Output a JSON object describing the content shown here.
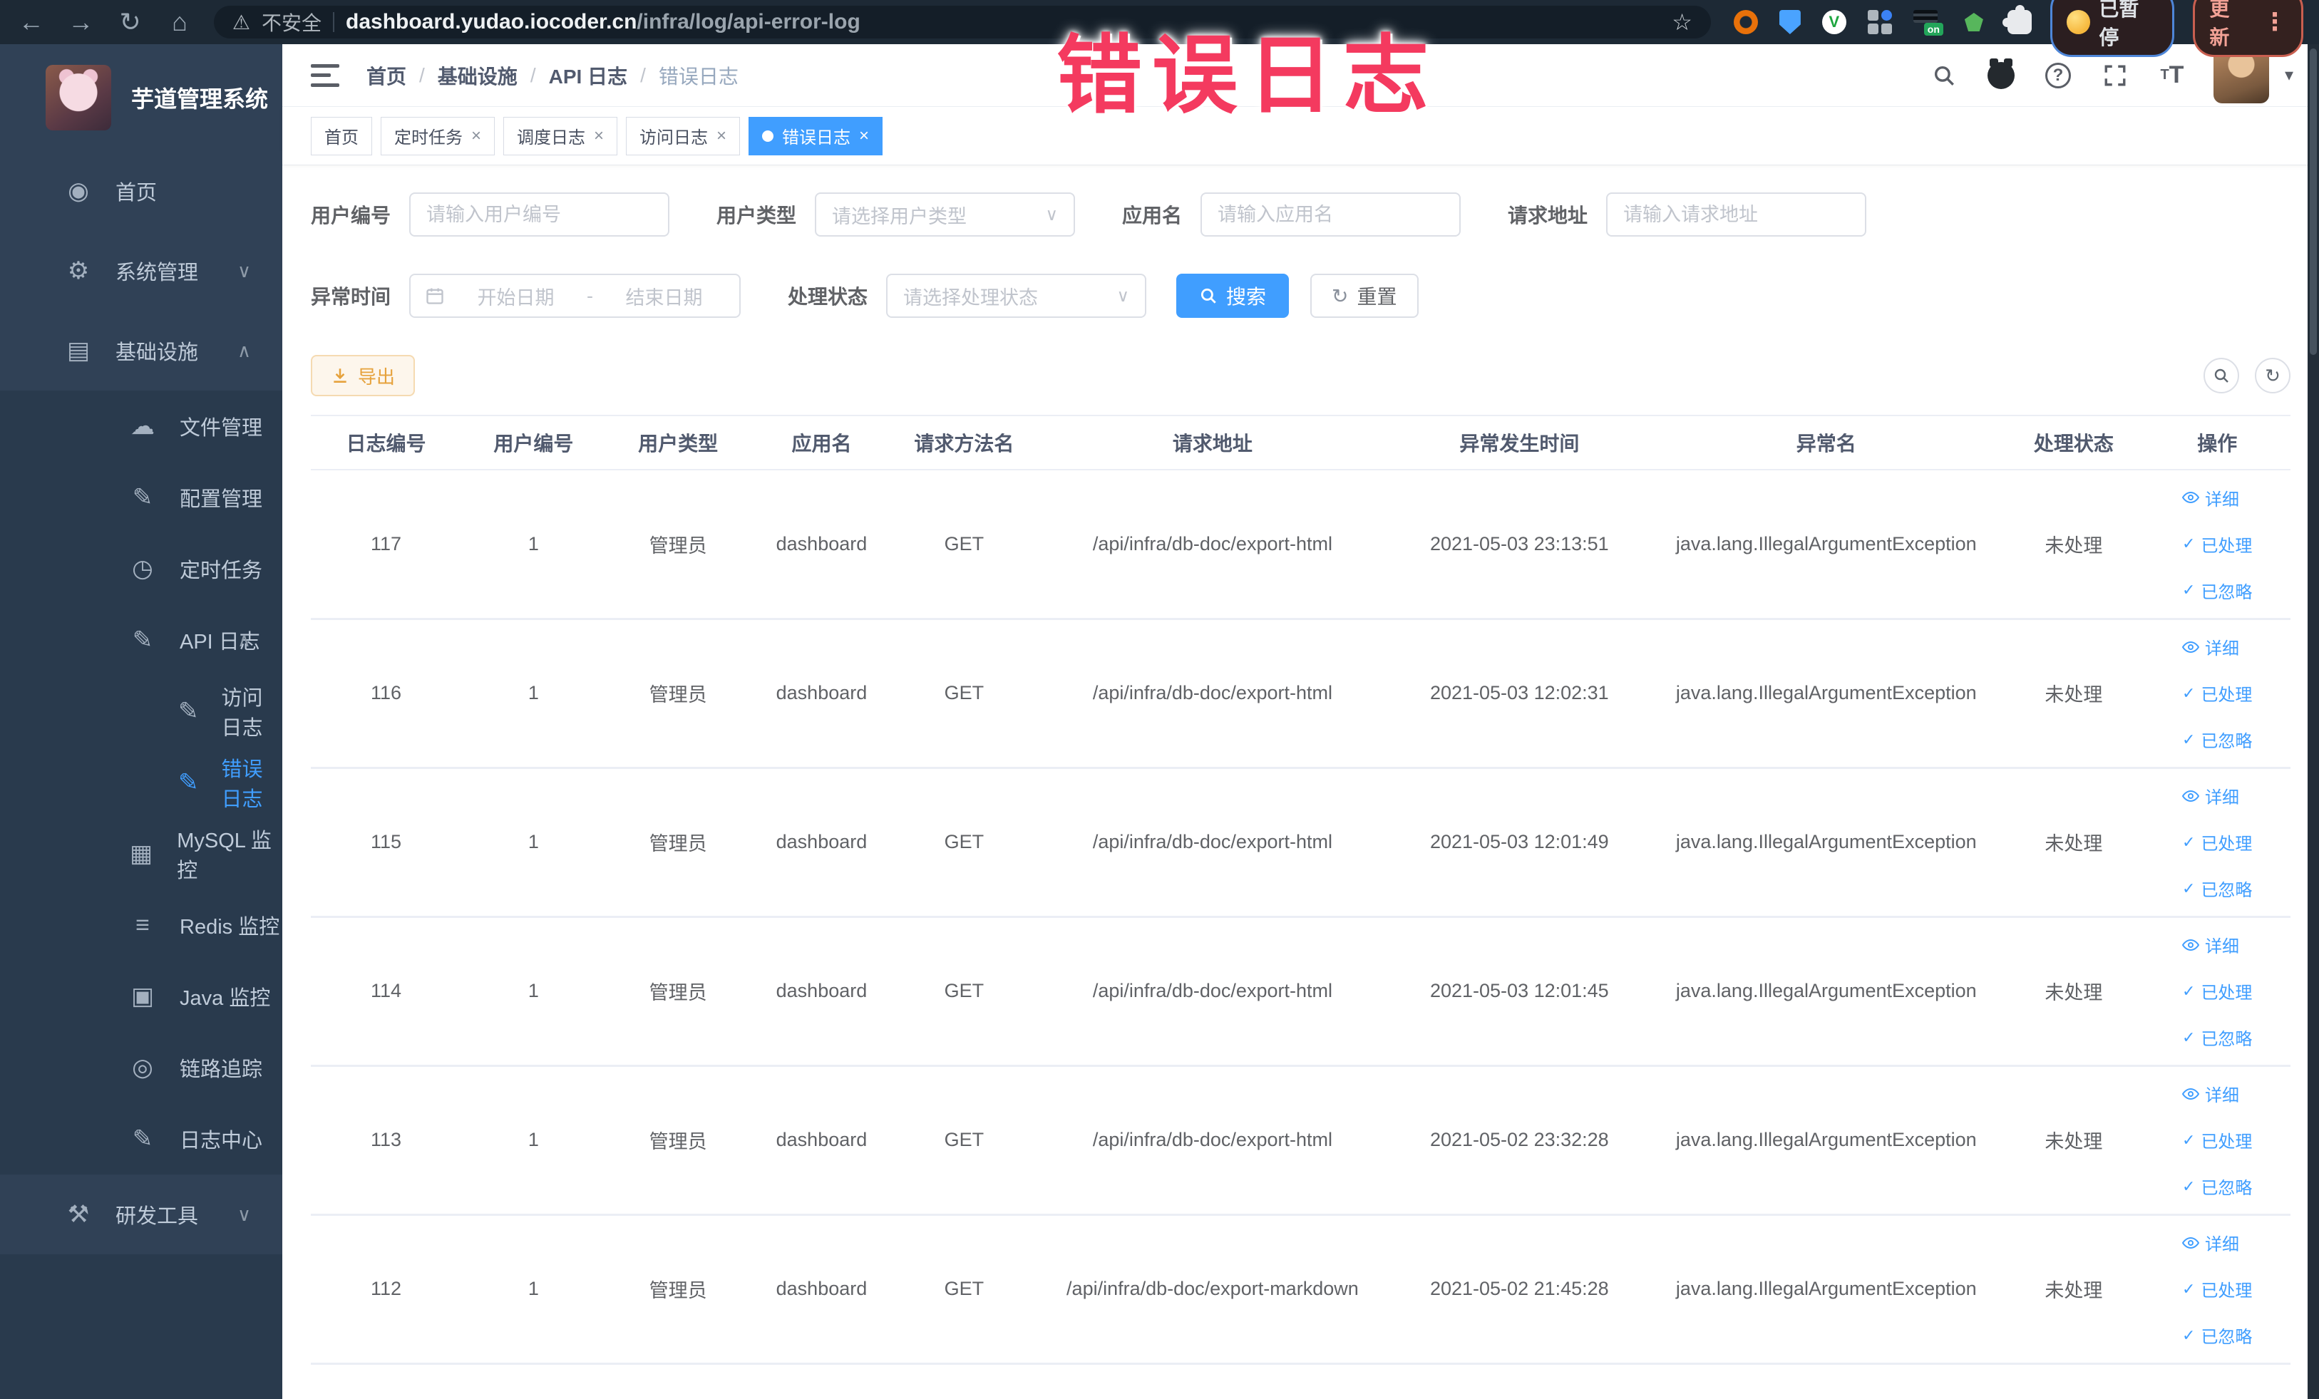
{
  "browser": {
    "security_label": "不安全",
    "url_domain": "dashboard.yudao.iocoder.cn",
    "url_path": "/infra/log/api-error-log",
    "paused_badge": "已暂停",
    "update_button": "更新",
    "ext_v_label": "V",
    "ext_on_label": "on"
  },
  "icons": {
    "back": "←",
    "forward": "→",
    "reload": "↻",
    "home": "⌂",
    "warning": "⚠",
    "star": "☆",
    "kebab": "⋮",
    "question": "?",
    "caret_down": "▾",
    "chevron_down": "∨",
    "chevron_up": "∧",
    "select_caret": "∨",
    "check": "✓",
    "close": "×",
    "reset": "↻",
    "refresh": "↻",
    "t_big": "T",
    "t_small": "T"
  },
  "overlay": {
    "title": "错误日志"
  },
  "sidebar": {
    "title": "芋道管理系统",
    "items": [
      {
        "label": "首页",
        "glyph": "◉"
      },
      {
        "label": "系统管理",
        "glyph": "⚙"
      },
      {
        "label": "基础设施",
        "glyph": "▤"
      },
      {
        "label": "文件管理",
        "glyph": "☁"
      },
      {
        "label": "配置管理",
        "glyph": "✎"
      },
      {
        "label": "定时任务",
        "glyph": "◷"
      },
      {
        "label": "API 日志",
        "glyph": "✎"
      },
      {
        "label": "访问日志",
        "glyph": "✎"
      },
      {
        "label": "错误日志",
        "glyph": "✎"
      },
      {
        "label": "MySQL 监控",
        "glyph": "▦"
      },
      {
        "label": "Redis 监控",
        "glyph": "≡"
      },
      {
        "label": "Java 监控",
        "glyph": "▣"
      },
      {
        "label": "链路追踪",
        "glyph": "◎"
      },
      {
        "label": "日志中心",
        "glyph": "✎"
      },
      {
        "label": "研发工具",
        "glyph": "⚒"
      }
    ]
  },
  "breadcrumb": {
    "separator": "/",
    "items": [
      "首页",
      "基础设施",
      "API 日志",
      "错误日志"
    ]
  },
  "tabs": [
    {
      "label": "首页"
    },
    {
      "label": "定时任务"
    },
    {
      "label": "调度日志"
    },
    {
      "label": "访问日志"
    },
    {
      "label": "错误日志"
    }
  ],
  "filters": {
    "user_id_label": "用户编号",
    "user_id_placeholder": "请输入用户编号",
    "user_type_label": "用户类型",
    "user_type_placeholder": "请选择用户类型",
    "app_name_label": "应用名",
    "app_name_placeholder": "请输入应用名",
    "request_url_label": "请求地址",
    "request_url_placeholder": "请输入请求地址",
    "time_label": "异常时间",
    "time_start_placeholder": "开始日期",
    "time_separator": "-",
    "time_end_placeholder": "结束日期",
    "status_label": "处理状态",
    "status_placeholder": "请选择处理状态",
    "search_label": "搜索",
    "reset_label": "重置"
  },
  "toolbar": {
    "export_label": "导出"
  },
  "table": {
    "columns": [
      "日志编号",
      "用户编号",
      "用户类型",
      "应用名",
      "请求方法名",
      "请求地址",
      "异常发生时间",
      "异常名",
      "处理状态",
      "操作"
    ],
    "actions": {
      "detail": "详细",
      "done": "已处理",
      "ignore": "已忽略"
    },
    "rows": [
      {
        "id": "117",
        "user_id": "1",
        "user_type": "管理员",
        "app": "dashboard",
        "method": "GET",
        "url": "/api/infra/db-doc/export-html",
        "time": "2021-05-03 23:13:51",
        "exception": "java.lang.IllegalArgumentException",
        "status": "未处理"
      },
      {
        "id": "116",
        "user_id": "1",
        "user_type": "管理员",
        "app": "dashboard",
        "method": "GET",
        "url": "/api/infra/db-doc/export-html",
        "time": "2021-05-03 12:02:31",
        "exception": "java.lang.IllegalArgumentException",
        "status": "未处理"
      },
      {
        "id": "115",
        "user_id": "1",
        "user_type": "管理员",
        "app": "dashboard",
        "method": "GET",
        "url": "/api/infra/db-doc/export-html",
        "time": "2021-05-03 12:01:49",
        "exception": "java.lang.IllegalArgumentException",
        "status": "未处理"
      },
      {
        "id": "114",
        "user_id": "1",
        "user_type": "管理员",
        "app": "dashboard",
        "method": "GET",
        "url": "/api/infra/db-doc/export-html",
        "time": "2021-05-03 12:01:45",
        "exception": "java.lang.IllegalArgumentException",
        "status": "未处理"
      },
      {
        "id": "113",
        "user_id": "1",
        "user_type": "管理员",
        "app": "dashboard",
        "method": "GET",
        "url": "/api/infra/db-doc/export-html",
        "time": "2021-05-02 23:32:28",
        "exception": "java.lang.IllegalArgumentException",
        "status": "未处理"
      },
      {
        "id": "112",
        "user_id": "1",
        "user_type": "管理员",
        "app": "dashboard",
        "method": "GET",
        "url": "/api/infra/db-doc/export-markdown",
        "time": "2021-05-02 21:45:28",
        "exception": "java.lang.IllegalArgumentException",
        "status": "未处理"
      }
    ]
  }
}
